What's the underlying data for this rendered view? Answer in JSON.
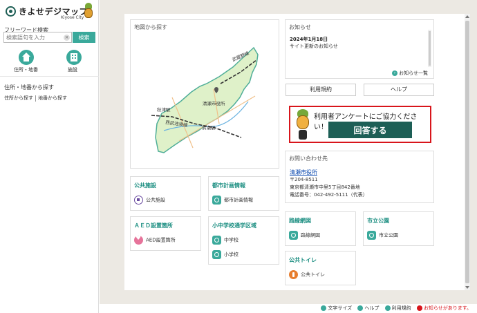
{
  "logo": {
    "title": "きよせデジマップ",
    "subtitle": "Kiyose City"
  },
  "sidebar": {
    "freeword_label": "フリーワード検索",
    "search_placeholder": "検索語句を入力",
    "search_button": "検索",
    "nav": [
      {
        "label": "住所・地番",
        "icon": "home-icon"
      },
      {
        "label": "施設",
        "icon": "building-icon"
      }
    ],
    "heading": "住所・地番から探す",
    "links": [
      "住所から探す",
      "地番から探す"
    ]
  },
  "map_panel": {
    "title": "地図から探す",
    "labels": {
      "musashino_line": "武蔵野線",
      "city_hall": "清瀬市役所",
      "akitsu": "秋津駅",
      "seibu_ikebukuro": "西武池袋線",
      "kiyose": "清瀬駅"
    },
    "colors": {
      "land": "#dff1c9",
      "border": "#4fae98",
      "water": "#6bb3e0",
      "road": "#f0c08a"
    }
  },
  "news": {
    "title": "お知らせ",
    "date": "2024年1月18日",
    "text": "サイト更新のお知らせ",
    "more": "お知らせ一覧"
  },
  "buttons": {
    "terms": "利用規約",
    "help": "ヘルプ"
  },
  "survey": {
    "text": "利用者アンケートにご協力ください！",
    "answer": "回答する",
    "border_color": "#d8151b",
    "button_color": "#1d5f56"
  },
  "contact": {
    "title": "お問い合わせ先",
    "office": "清瀬市役所",
    "postal": "〒204-8511",
    "address": "東京都清瀬市中里5丁目842番地",
    "phone": "電話番号：042-492-5111（代表）"
  },
  "categories": {
    "public_facilities": {
      "title": "公共施設",
      "items": [
        "公共施設"
      ]
    },
    "aed": {
      "title": "ＡＥＤ設置箇所",
      "items": [
        "AED設置箇所"
      ]
    },
    "urban_planning": {
      "title": "都市計画情報",
      "items": [
        "都市計画情報"
      ]
    },
    "school_district": {
      "title": "小中学校通学区域",
      "items": [
        "中学校",
        "小学校"
      ]
    },
    "road_network": {
      "title": "路線網図",
      "items": [
        "路線網図"
      ]
    },
    "city_park": {
      "title": "市立公園",
      "items": [
        "市立公園"
      ]
    },
    "public_toilet": {
      "title": "公共トイレ",
      "items": [
        "公共トイレ"
      ]
    }
  },
  "footer": {
    "text_size": "文字サイズ",
    "help": "ヘルプ",
    "terms": "利用規約",
    "alert": "お知らせがあります。"
  },
  "theme": {
    "accent": "#3aa99b",
    "heading_teal": "#1d8f82",
    "background": "#ece9e3"
  }
}
